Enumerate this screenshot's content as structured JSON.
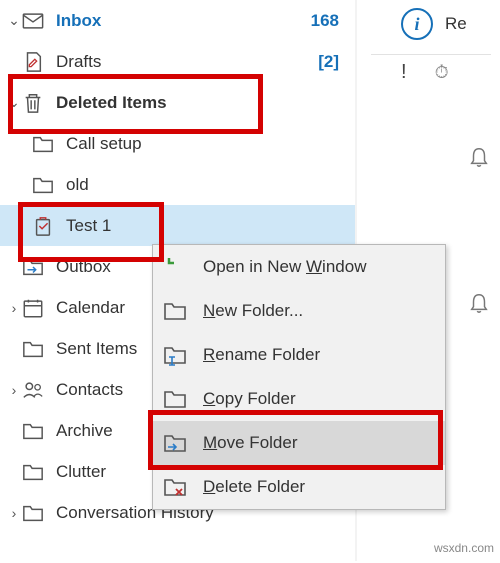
{
  "sidebar": {
    "items": [
      {
        "label": "Inbox",
        "count": "168"
      },
      {
        "label": "Drafts",
        "count": "[2]"
      },
      {
        "label": "Deleted Items"
      },
      {
        "label": "Call setup"
      },
      {
        "label": "old"
      },
      {
        "label": "Test 1"
      },
      {
        "label": "Outbox"
      },
      {
        "label": "Calendar"
      },
      {
        "label": "Sent Items"
      },
      {
        "label": "Contacts"
      },
      {
        "label": "Archive"
      },
      {
        "label": "Clutter"
      },
      {
        "label": "Conversation History"
      }
    ]
  },
  "context_menu": {
    "items": [
      {
        "pre": "Open in New ",
        "u": "W",
        "post": "indow"
      },
      {
        "pre": "",
        "u": "N",
        "post": "ew Folder..."
      },
      {
        "pre": "",
        "u": "R",
        "post": "ename Folder"
      },
      {
        "pre": "",
        "u": "C",
        "post": "opy Folder"
      },
      {
        "pre": "",
        "u": "M",
        "post": "ove Folder"
      },
      {
        "pre": "",
        "u": "D",
        "post": "elete Folder"
      }
    ]
  },
  "right": {
    "reply": "Re",
    "exclaim": "!"
  },
  "watermark": "wsxdn.com"
}
